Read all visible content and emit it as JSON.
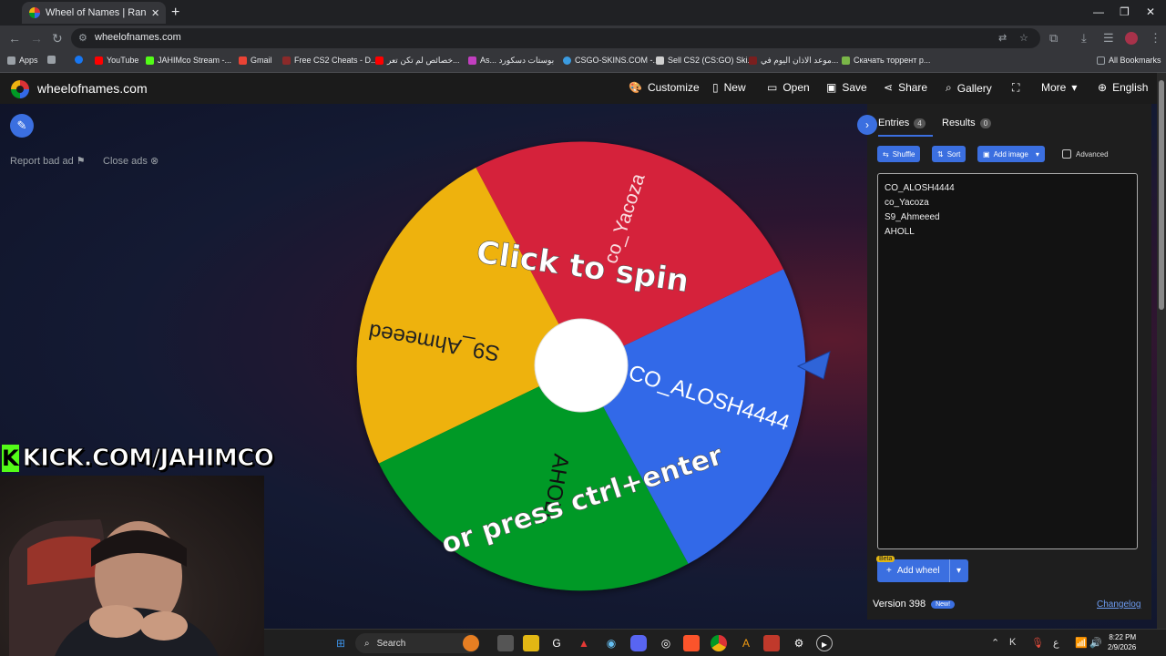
{
  "browser": {
    "tab_title": "Wheel of Names | Random nam",
    "url": "wheelofnames.com",
    "bookmarks": [
      {
        "label": "Apps",
        "color": "#e8eaed"
      },
      {
        "label": "",
        "color": "#1877f2"
      },
      {
        "label": "YouTube",
        "color": "#ff0000"
      },
      {
        "label": "JAHIMco Stream -...",
        "color": "#53fc18"
      },
      {
        "label": "Gmail",
        "color": "#ea4335"
      },
      {
        "label": "Free CS2 Cheats - D...",
        "color": "#8b2a2a"
      },
      {
        "label": "خصائص لم تكن تعر...",
        "color": "#ff0000"
      },
      {
        "label": "As... بوستات دسكورد",
        "color": "#c23fc0"
      },
      {
        "label": "CSGO-SKINS.COM -...",
        "color": "#3b9be0"
      },
      {
        "label": "Sell CS2 (CS:GO) Ski...",
        "color": "#d0d0d0"
      },
      {
        "label": "موعد الاذان اليوم في...",
        "color": "#7a1f1f"
      },
      {
        "label": "Скачать торрент р...",
        "color": "#7ab648"
      }
    ],
    "all_bookmarks": "All Bookmarks"
  },
  "app": {
    "site_name": "wheelofnames.com",
    "menu": [
      "Customize",
      "New",
      "Open",
      "Save",
      "Share",
      "Gallery",
      "More",
      "English"
    ]
  },
  "ads": {
    "report": "Report bad ad",
    "close": "Close ads"
  },
  "wheel": {
    "center_top_text": "Click to spin",
    "center_bottom_text": "or press ctrl+enter",
    "segments": [
      {
        "name": "CO_ALOSH4444",
        "color": "#3369e8"
      },
      {
        "name": "co_Yacoza",
        "color": "#d5243a"
      },
      {
        "name": "S9_Ahmeeed",
        "color": "#eeb211"
      },
      {
        "name": "AHOLL",
        "color": "#009925"
      }
    ]
  },
  "sidebar": {
    "tab_entries": "Entries",
    "entries_count": "4",
    "tab_results": "Results",
    "results_count": "0",
    "shuffle": "Shuffle",
    "sort": "Sort",
    "add_image": "Add image",
    "advanced": "Advanced",
    "entries": [
      "CO_ALOSH4444",
      "co_Yacoza",
      "S9_Ahmeeed",
      "AHOLL"
    ],
    "beta": "Beta",
    "add_wheel": "Add wheel",
    "version": "Version 398",
    "new_badge": "New!",
    "changelog": "Changelog"
  },
  "stream": {
    "kick_text": "KICK.COM/JAHIMCO"
  },
  "taskbar": {
    "search": "Search",
    "lang": "ع",
    "time": "8:22 PM",
    "date": "2/9/2026"
  }
}
